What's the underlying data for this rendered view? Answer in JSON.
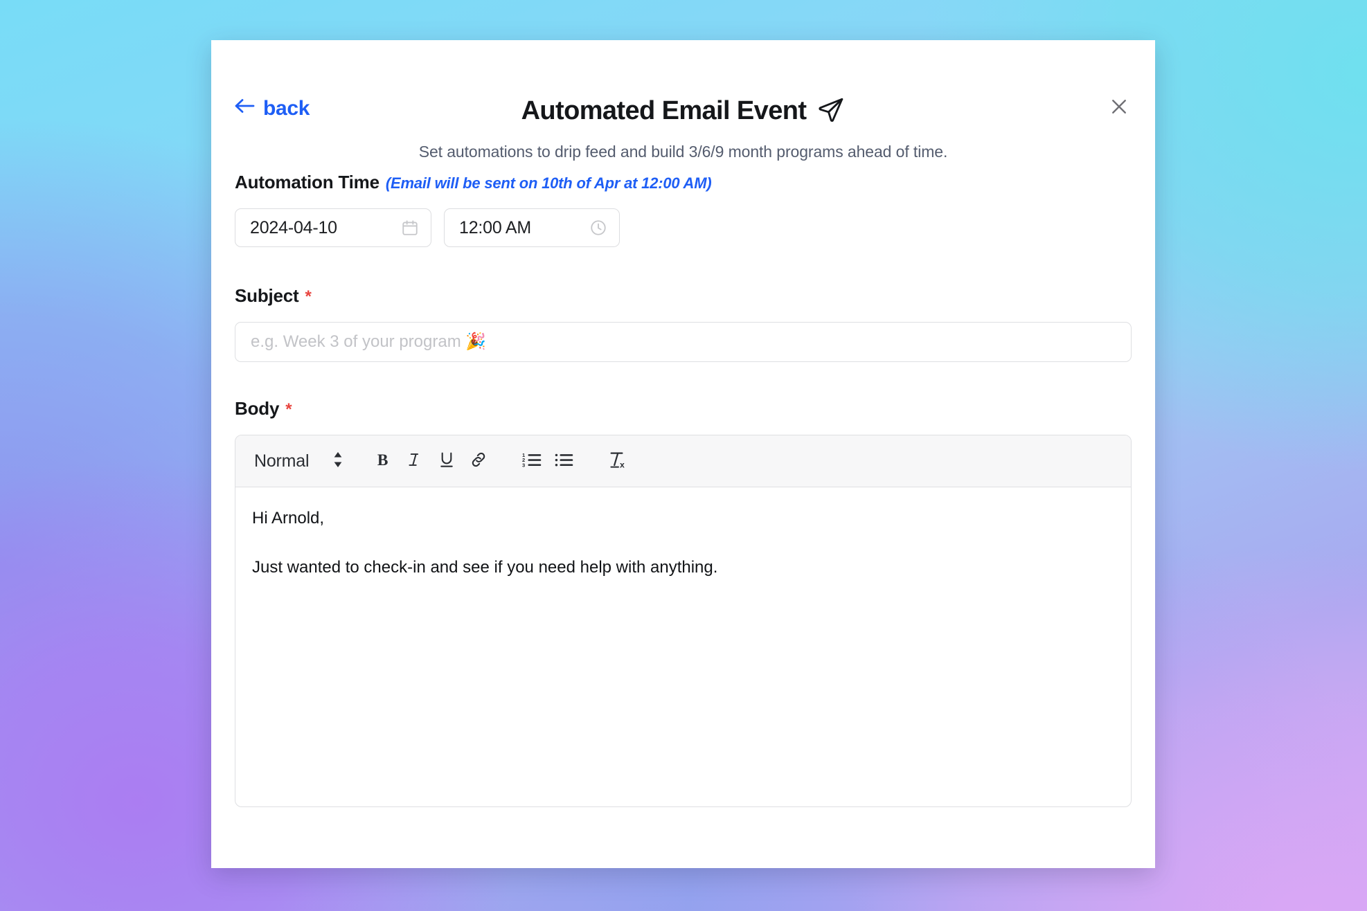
{
  "background": {
    "accent_cyan": "#78dcf7",
    "accent_purple": "#ab7df2",
    "accent_lavender": "#c9a6f2"
  },
  "modal": {
    "back_label": "back",
    "title": "Automated Email Event",
    "title_icon": "send-paper-plane-icon",
    "close_icon": "close-icon",
    "subtitle": "Set automations to drip feed and build 3/6/9 month programs ahead of time."
  },
  "automation_time": {
    "label": "Automation Time",
    "hint": "(Email will be sent on 10th of Apr at 12:00 AM)",
    "hint_color": "#1e5ef5",
    "date_value": "2024-04-10",
    "date_icon": "calendar-icon",
    "time_value": "12:00 AM",
    "time_icon": "clock-icon"
  },
  "subject": {
    "label": "Subject",
    "required_marker": "*",
    "required_color": "#e8443f",
    "value": "",
    "placeholder": "e.g. Week 3 of your program 🎉"
  },
  "body": {
    "label": "Body",
    "required_marker": "*",
    "toolbar": {
      "format_label": "Normal",
      "format_caret_icon": "chevron-up-down-icon",
      "buttons": [
        {
          "name": "bold-icon",
          "label": "B"
        },
        {
          "name": "italic-icon",
          "label": "I"
        },
        {
          "name": "underline-icon",
          "label": "U"
        },
        {
          "name": "link-icon",
          "label": ""
        },
        {
          "name": "ordered-list-icon",
          "label": ""
        },
        {
          "name": "bullet-list-icon",
          "label": ""
        },
        {
          "name": "clear-formatting-icon",
          "label": ""
        }
      ]
    },
    "content": {
      "line1": "Hi Arnold,",
      "line2": "Just wanted to check-in and see if you need help with anything."
    }
  }
}
